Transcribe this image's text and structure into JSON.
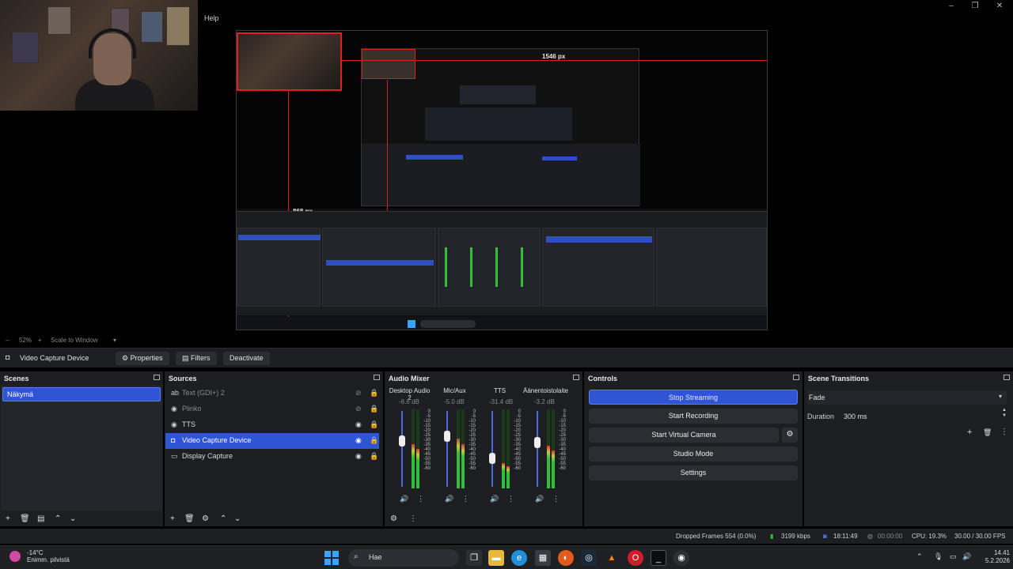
{
  "menu": {
    "help": "Help"
  },
  "preview": {
    "width_label": "1546 px",
    "height_label": "868 px",
    "zoom": "52%",
    "scale_mode": "Scale to Window"
  },
  "context_bar": {
    "source_name": "Video Capture Device",
    "properties": "Properties",
    "filters": "Filters",
    "deactivate": "Deactivate"
  },
  "scenes": {
    "title": "Scenes",
    "items": [
      {
        "label": "Näkymä"
      }
    ]
  },
  "sources": {
    "title": "Sources",
    "items": [
      {
        "label": "Text (GDI+) 2",
        "icon": "text-icon",
        "visible": false
      },
      {
        "label": "Plinko",
        "icon": "browser-icon",
        "visible": false
      },
      {
        "label": "TTS",
        "icon": "browser-icon",
        "visible": true
      },
      {
        "label": "Video Capture Device",
        "icon": "camera-icon",
        "visible": true
      },
      {
        "label": "Display Capture",
        "icon": "monitor-icon",
        "visible": true
      }
    ]
  },
  "audio_mixer": {
    "title": "Audio Mixer",
    "channels": [
      {
        "name": "Desktop Audio 2",
        "db": "-6.6 dB",
        "level": 0.62
      },
      {
        "name": "Mic/Aux",
        "db": "-5.0 dB",
        "level": 0.7
      },
      {
        "name": "TTS",
        "db": "-31.4 dB",
        "level": 0.35
      },
      {
        "name": "Äänentoistolaite",
        "db": "-3.2 dB",
        "level": 0.6
      }
    ],
    "scale": [
      "0",
      "-5",
      "-10",
      "-15",
      "-20",
      "-25",
      "-30",
      "-35",
      "-40",
      "-45",
      "-50",
      "-55",
      "-60"
    ]
  },
  "controls": {
    "title": "Controls",
    "stop_streaming": "Stop Streaming",
    "start_recording": "Start Recording",
    "start_virtual_camera": "Start Virtual Camera",
    "studio_mode": "Studio Mode",
    "settings": "Settings"
  },
  "transitions": {
    "title": "Scene Transitions",
    "selected": "Fade",
    "duration_label": "Duration",
    "duration_value": "300 ms"
  },
  "status": {
    "dropped_frames": "Dropped Frames 554 (0.0%)",
    "bitrate": "3199 kbps",
    "stream_time": "18:11:49",
    "rec_time": "00:00:00",
    "cpu": "CPU: 19.3%",
    "fps": "30.00 / 30.00 FPS"
  },
  "taskbar": {
    "weather_temp": "-14°C",
    "weather_desc": "Enimm. pilvistä",
    "search_placeholder": "Hae",
    "time": "14.41",
    "date": "5.2.2026"
  },
  "colors": {
    "accent": "#2f55d4",
    "panel": "#1d1e22",
    "meter_green": "#2fbf3a",
    "alert_red": "#d42020"
  }
}
